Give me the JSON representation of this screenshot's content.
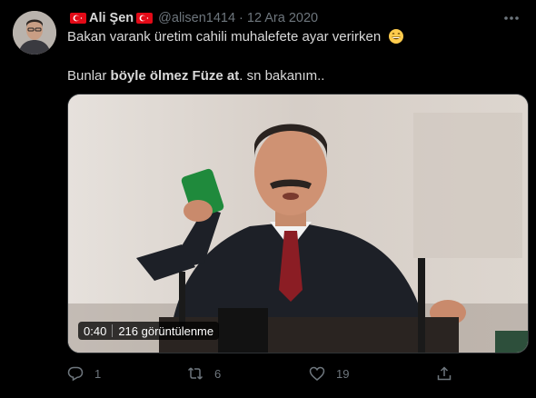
{
  "author": {
    "name": "Ali Şen",
    "handle": "@alisen1414",
    "separator": "·",
    "date": "12 Ara 2020"
  },
  "tweet": {
    "line1": "Bakan varank üretim cahili muhalefete ayar verirken",
    "line2_pre": "Bunlar ",
    "line2_bold": "böyle ölmez Füze at",
    "line2_post": ". sn bakanım.."
  },
  "video": {
    "duration": "0:40",
    "views": "216 görüntülenme"
  },
  "actions": {
    "reply_count": "1",
    "retweet_count": "6",
    "like_count": "19"
  },
  "icons": {
    "flag": "turkey-flag-icon",
    "emoji": "grinning-face-icon",
    "more": "more-options-icon",
    "reply": "reply-icon",
    "retweet": "retweet-icon",
    "like": "like-icon",
    "share": "share-icon"
  },
  "colors": {
    "background": "#000000",
    "text": "#d9d9d9",
    "muted": "#6e767d",
    "flag_red": "#e30a17"
  }
}
